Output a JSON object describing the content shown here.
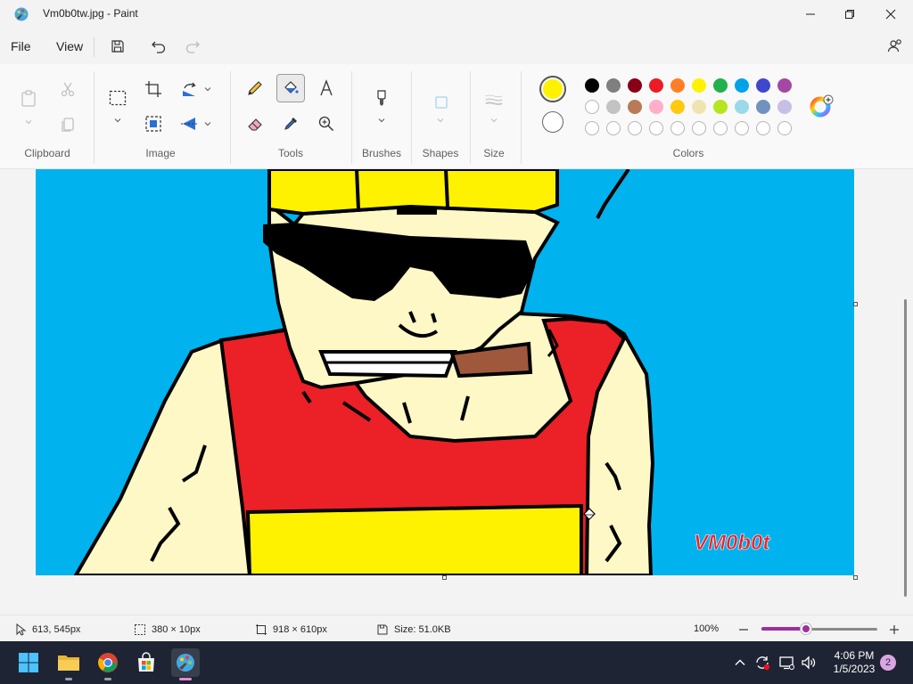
{
  "window": {
    "title": "Vm0b0tw.jpg - Paint"
  },
  "menu": {
    "file_label": "File",
    "view_label": "View"
  },
  "ribbon": {
    "groups": {
      "clipboard": "Clipboard",
      "image": "Image",
      "tools": "Tools",
      "brushes": "Brushes",
      "shapes": "Shapes",
      "size": "Size",
      "colors": "Colors"
    },
    "selected_tool": "fill-bucket",
    "primary_color": "#fff200",
    "secondary_color": "#ffffff",
    "palette_row1": [
      "#000000",
      "#7f7f7f",
      "#880015",
      "#ed1c24",
      "#ff7f27",
      "#fff200",
      "#22b14c",
      "#00a2e8",
      "#3f48cc",
      "#a349a4"
    ],
    "palette_row2": [
      "#ffffff",
      "#c3c3c3",
      "#b97a57",
      "#ffaec9",
      "#ffc90e",
      "#efe4b0",
      "#b5e61d",
      "#99d9ea",
      "#7092be",
      "#c8bfe7"
    ],
    "palette_row3_count": 10
  },
  "canvas": {
    "watermark": "VM0b0t",
    "sky_color": "#00b2ee",
    "skin_color": "#fef8c6",
    "shirt_color": "#ec2027",
    "yellow_color": "#fff200",
    "cigar_color": "#a0583d"
  },
  "status": {
    "cursor_pos": "613, 545px",
    "selection_size": "380 × 10px",
    "canvas_size": "918 × 610px",
    "file_size": "Size: 51.0KB",
    "zoom": "100%",
    "zoom_level_percent": 38
  },
  "taskbar": {
    "time": "4:06 PM",
    "date": "1/5/2023",
    "notifications": "2"
  }
}
